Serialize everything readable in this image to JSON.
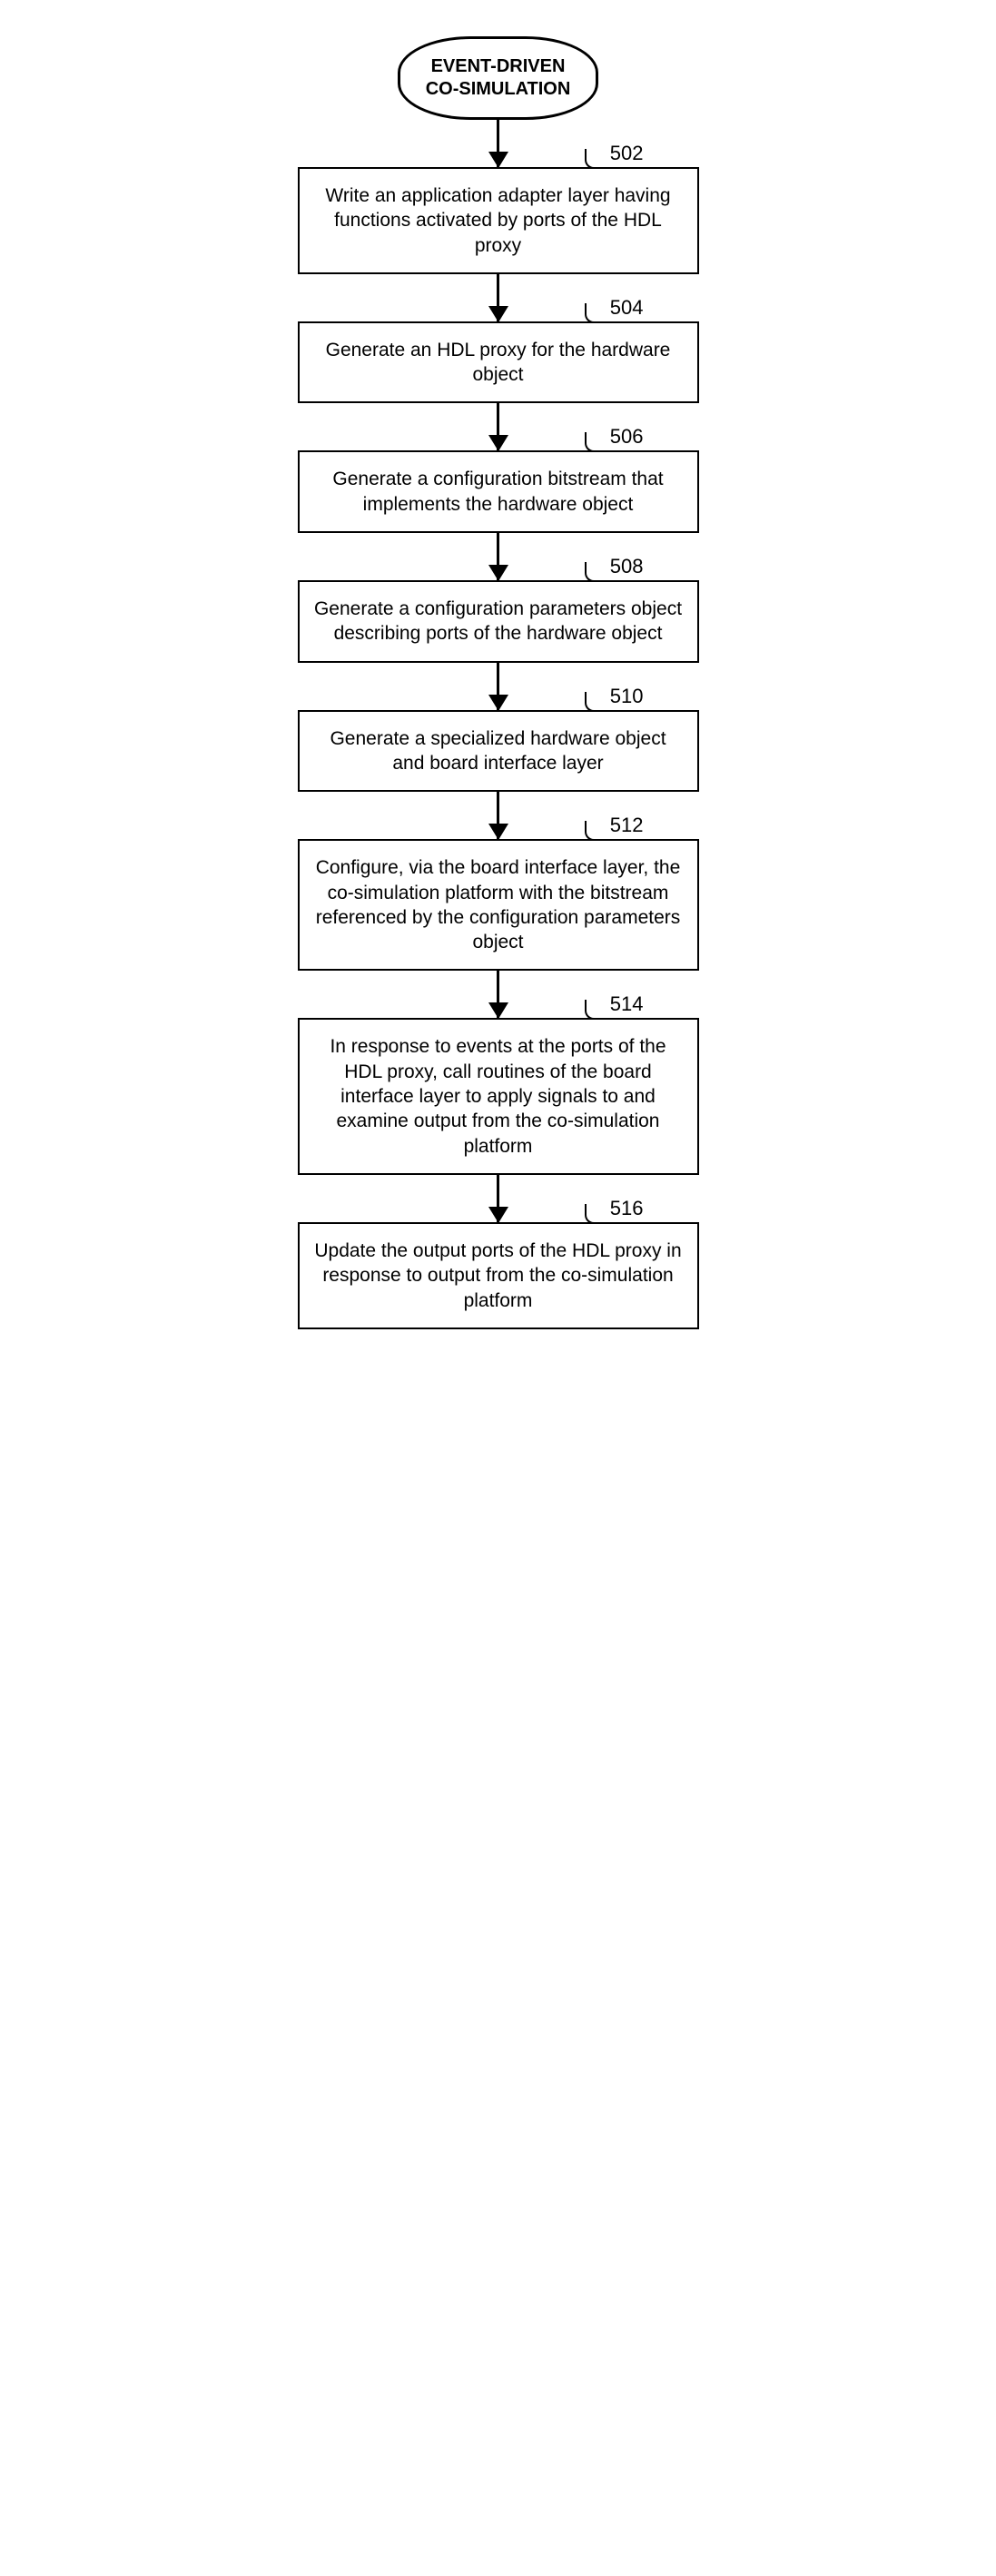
{
  "title_line1": "EVENT-DRIVEN",
  "title_line2": "CO-SIMULATION",
  "steps": {
    "s502": {
      "num": "502",
      "text": "Write an application adapter layer having functions activated by ports of the HDL proxy"
    },
    "s504": {
      "num": "504",
      "text": "Generate an HDL proxy for the hardware object"
    },
    "s506": {
      "num": "506",
      "text": "Generate a configuration bitstream that implements the hardware object"
    },
    "s508": {
      "num": "508",
      "text": "Generate a configuration parameters object describing ports of the hardware object"
    },
    "s510": {
      "num": "510",
      "text": "Generate a specialized hardware object and board interface layer"
    },
    "s512": {
      "num": "512",
      "text": "Configure, via the board interface layer, the co-simulation platform with the bitstream referenced by the configuration parameters object"
    },
    "s514": {
      "num": "514",
      "text": "In response to events at the ports of the HDL proxy, call routines of the board interface layer to apply signals to and examine output from the co-simulation platform"
    },
    "s516": {
      "num": "516",
      "text": "Update the output ports of the HDL proxy in response to output from the co-simulation platform"
    }
  }
}
